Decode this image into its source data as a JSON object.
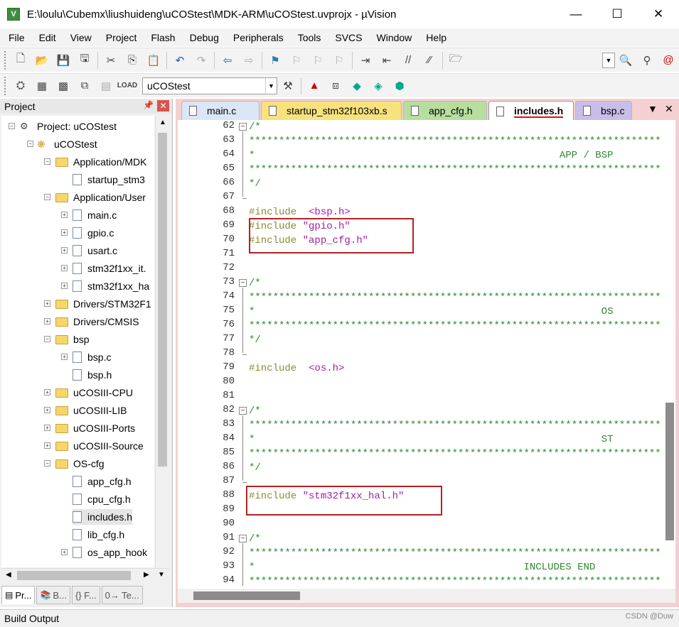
{
  "window": {
    "title": "E:\\loulu\\Cubemx\\liushuideng\\uCOStest\\MDK-ARM\\uCOStest.uvprojx - µVision",
    "app_icon_text": "V"
  },
  "menu": [
    "File",
    "Edit",
    "View",
    "Project",
    "Flash",
    "Debug",
    "Peripherals",
    "Tools",
    "SVCS",
    "Window",
    "Help"
  ],
  "toolbar": {
    "target_name": "uCOStest"
  },
  "project_panel": {
    "title": "Project",
    "root": "Project: uCOStest",
    "target": "uCOStest",
    "items": [
      {
        "label": "Application/MDK",
        "kind": "folder",
        "level": 2
      },
      {
        "label": "startup_stm3",
        "kind": "file",
        "level": 3
      },
      {
        "label": "Application/User",
        "kind": "folder",
        "level": 2
      },
      {
        "label": "main.c",
        "kind": "file",
        "level": 3
      },
      {
        "label": "gpio.c",
        "kind": "file",
        "level": 3
      },
      {
        "label": "usart.c",
        "kind": "file",
        "level": 3
      },
      {
        "label": "stm32f1xx_it.",
        "kind": "file",
        "level": 3
      },
      {
        "label": "stm32f1xx_ha",
        "kind": "file",
        "level": 3
      },
      {
        "label": "Drivers/STM32F1",
        "kind": "folder",
        "level": 2
      },
      {
        "label": "Drivers/CMSIS",
        "kind": "folder",
        "level": 2
      },
      {
        "label": "bsp",
        "kind": "folder",
        "level": 2
      },
      {
        "label": "bsp.c",
        "kind": "file",
        "level": 3
      },
      {
        "label": "bsp.h",
        "kind": "file",
        "level": 3
      },
      {
        "label": "uCOSIII-CPU",
        "kind": "folder",
        "level": 2
      },
      {
        "label": "uCOSIII-LIB",
        "kind": "folder",
        "level": 2
      },
      {
        "label": "uCOSIII-Ports",
        "kind": "folder",
        "level": 2
      },
      {
        "label": "uCOSIII-Source",
        "kind": "folder",
        "level": 2
      },
      {
        "label": "OS-cfg",
        "kind": "folder",
        "level": 2
      },
      {
        "label": "app_cfg.h",
        "kind": "file",
        "level": 3
      },
      {
        "label": "cpu_cfg.h",
        "kind": "file",
        "level": 3
      },
      {
        "label": "includes.h",
        "kind": "file",
        "level": 3
      },
      {
        "label": "lib_cfg.h",
        "kind": "file",
        "level": 3
      },
      {
        "label": "os_app_hook",
        "kind": "file",
        "level": 3
      }
    ],
    "tabs": [
      "Pr...",
      "B...",
      "{} F...",
      "0→ Te..."
    ]
  },
  "editor": {
    "tabs": [
      "main.c",
      "startup_stm32f103xb.s",
      "app_cfg.h",
      "includes.h",
      "bsp.c"
    ],
    "active_tab": "includes.h",
    "lines": [
      {
        "n": "62",
        "text": "/*"
      },
      {
        "n": "63",
        "text": "*********************************************************************"
      },
      {
        "n": "64",
        "text": "*                                                   APP / BSP"
      },
      {
        "n": "65",
        "text": "*********************************************************************"
      },
      {
        "n": "66",
        "text": "*/"
      },
      {
        "n": "67",
        "text": ""
      },
      {
        "n": "68",
        "text": "#include  <bsp.h>"
      },
      {
        "n": "69",
        "text": "#include \"gpio.h\""
      },
      {
        "n": "70",
        "text": "#include \"app_cfg.h\""
      },
      {
        "n": "71",
        "text": ""
      },
      {
        "n": "72",
        "text": ""
      },
      {
        "n": "73",
        "text": "/*"
      },
      {
        "n": "74",
        "text": "*********************************************************************"
      },
      {
        "n": "75",
        "text": "*                                                          OS"
      },
      {
        "n": "76",
        "text": "*********************************************************************"
      },
      {
        "n": "77",
        "text": "*/"
      },
      {
        "n": "78",
        "text": ""
      },
      {
        "n": "79",
        "text": "#include  <os.h>"
      },
      {
        "n": "80",
        "text": ""
      },
      {
        "n": "81",
        "text": ""
      },
      {
        "n": "82",
        "text": "/*"
      },
      {
        "n": "83",
        "text": "*********************************************************************"
      },
      {
        "n": "84",
        "text": "*                                                          ST"
      },
      {
        "n": "85",
        "text": "*********************************************************************"
      },
      {
        "n": "86",
        "text": "*/"
      },
      {
        "n": "87",
        "text": ""
      },
      {
        "n": "88",
        "text": "#include \"stm32f1xx_hal.h\""
      },
      {
        "n": "89",
        "text": ""
      },
      {
        "n": "90",
        "text": ""
      },
      {
        "n": "91",
        "text": "/*"
      },
      {
        "n": "92",
        "text": "*********************************************************************"
      },
      {
        "n": "93",
        "text": "*                                             INCLUDES END"
      },
      {
        "n": "94",
        "text": "*********************************************************************"
      }
    ]
  },
  "build_output": {
    "title": "Build Output"
  },
  "watermark": "CSDN @Duw"
}
